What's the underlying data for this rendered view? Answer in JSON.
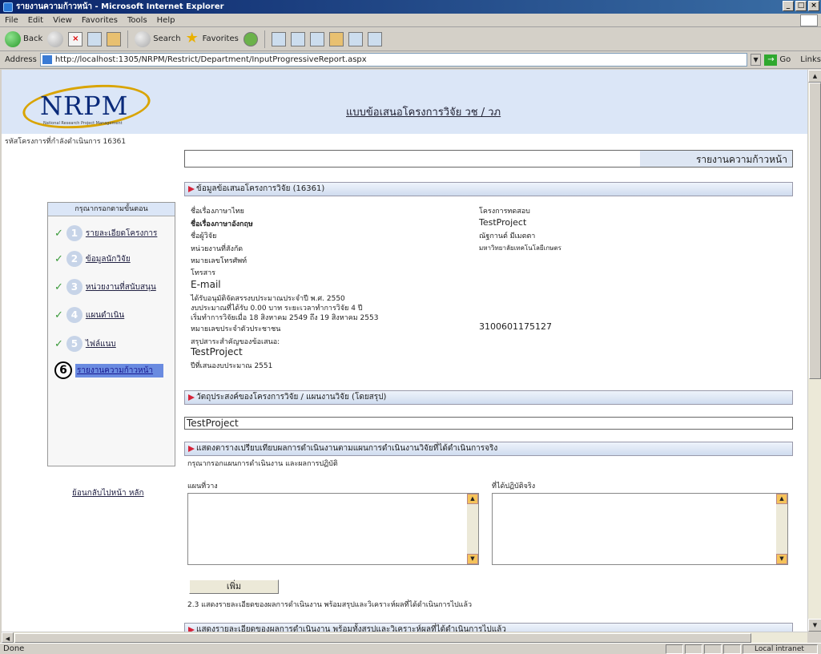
{
  "window": {
    "title": "รายงานความก้าวหน้า - Microsoft Internet Explorer",
    "controls": [
      "_",
      "□",
      "×"
    ]
  },
  "menu": [
    "File",
    "Edit",
    "View",
    "Favorites",
    "Tools",
    "Help"
  ],
  "toolbar": {
    "back": "Back",
    "search": "Search",
    "favorites": "Favorites"
  },
  "address": {
    "label": "Address",
    "url": "http://localhost:1305/NRPM/Restrict/Department/InputProgressiveReport.aspx",
    "go": "Go",
    "links": "Links"
  },
  "status": {
    "text": "Done",
    "zone": "Local intranet"
  },
  "page": {
    "logo": "NRPM",
    "logo_sub": "National Research Project Management",
    "header_title": "แบบข้อเสนอโครงการวิจัย วช / วภ",
    "project_code": "รหัสโครงการที่กำลังดำเนินการ 16361",
    "report_title": "รายงานความก้าวหน้า"
  },
  "sidebar": {
    "title": "กรุณากรอกตามขั้นตอน",
    "items": [
      {
        "num": "1",
        "label": "รายละเอียดโครงการ"
      },
      {
        "num": "2",
        "label": "ข้อมูลนักวิจัย"
      },
      {
        "num": "3",
        "label": "หน่วยงานที่สนับสนุน"
      },
      {
        "num": "4",
        "label": "แผนดำเนิน"
      },
      {
        "num": "5",
        "label": "ไฟล์แนบ"
      },
      {
        "num": "6",
        "label": "รายงานความก้าวหน้า"
      }
    ],
    "back": "ย้อนกลับไปหน้า หลัก"
  },
  "info": {
    "header": "ข้อมูลข้อเสนอโครงการวิจัย (16361)",
    "left_labels": [
      "ชื่อเรื่องภาษาไทย",
      "ชื่อเรื่องภาษาอังกฤษ",
      "ชื่อผู้วิจัย",
      "หน่วยงานที่สังกัด",
      "หมายเลขโทรศัพท์",
      "โทรสาร",
      "E-mail",
      "ได้รับอนุมัติจัดสรรงบประมาณประจำปี พ.ศ. 2550",
      "งบประมาณที่ได้รับ 0.00 บาท ระยะเวลาทำการวิจัย 4 ปี",
      "เริ่มทำการวิจัยเมื่อ 18 สิงหาคม 2549 ถึง 19 สิงหาคม 2553",
      "หมายเลขประจำตัวประชาชน",
      "สรุปสาระสำคัญของข้อเสนอ:",
      "TestProject",
      "ปีที่เสนองบประมาณ 2551"
    ],
    "right_values": [
      "โครงการทดสอบ",
      "TestProject",
      "ณัฐกานต์ มีเมตตา",
      "มหาวิทยาลัยเทคโนโลยีเกษตร",
      "3100601175127"
    ]
  },
  "objective": {
    "header": "วัตถุประสงค์ของโครงการวิจัย / แผนงานวิจัย (โดยสรุป)",
    "value": "TestProject"
  },
  "comparison": {
    "header": "แสดงตารางเปรียบเทียบผลการดำเนินงานตามแผนการดำเนินงานวิจัยที่ได้ดำเนินการจริง",
    "instruction": "กรุณากรอกแผนการดำเนินงาน และผลการปฏิบัติ",
    "planned_label": "แผนที่วาง",
    "actual_label": "ที่ได้ปฏิบัติจริง",
    "add_button": "เพิ่ม",
    "note": "2.3 แสดงรายละเอียดของผลการดำเนินงาน พร้อมสรุปและวิเคราะห์ผลที่ได้ดำเนินการไปแล้ว"
  },
  "next_section": {
    "header": "แสดงรายละเอียดของผลการดำเนินงาน พร้อมทั้งสรุปและวิเคราะห์ผลที่ได้ดำเนินการไปแล้ว"
  }
}
